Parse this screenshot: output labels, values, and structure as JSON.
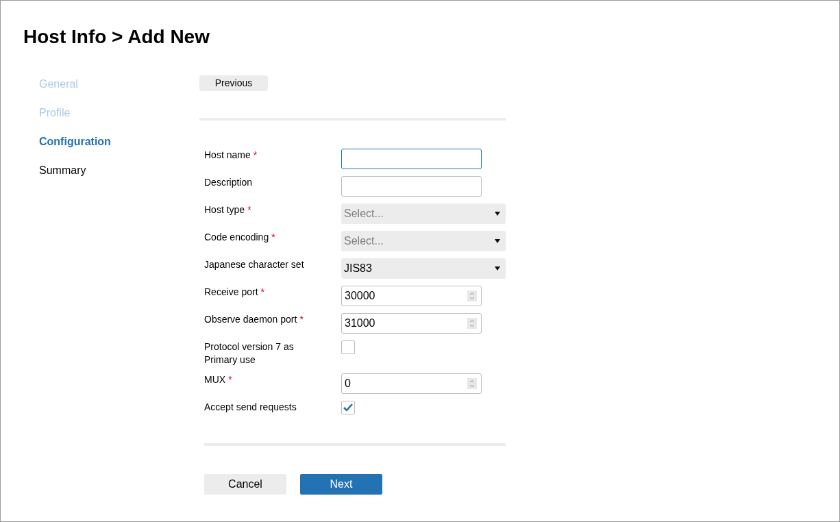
{
  "title": "Host Info > Add New",
  "steps": [
    {
      "label": "General",
      "selected": false,
      "visited": true
    },
    {
      "label": "Profile",
      "selected": false,
      "visited": true
    },
    {
      "label": "Configuration",
      "selected": true,
      "visited": true
    },
    {
      "label": "Summary",
      "selected": false,
      "visited": false
    }
  ],
  "previous_button": "Previous",
  "fields": [
    {
      "kind": "text",
      "label": "Host name",
      "required_mark": "*",
      "focused": true
    },
    {
      "kind": "text",
      "label": "Description",
      "focused": false
    },
    {
      "kind": "select",
      "label": "Host type",
      "required_mark": "*",
      "placeholder": "Select..."
    },
    {
      "kind": "select",
      "label": "Code encoding",
      "required_mark": "*",
      "placeholder": "Select..."
    },
    {
      "kind": "select",
      "label": "Japanese character set",
      "value": "JIS83"
    },
    {
      "kind": "number",
      "label": "Receive port",
      "required_mark": "*",
      "value": "30000"
    },
    {
      "kind": "number",
      "label": "Observe daemon port",
      "required_mark": "*",
      "value": "31000"
    },
    {
      "kind": "checkbox",
      "label": "Protocol version 7 as Primary use",
      "checked": false
    },
    {
      "kind": "number",
      "label": "MUX",
      "required_mark": "*",
      "value": "0"
    },
    {
      "kind": "checkbox",
      "label": "Accept send requests",
      "checked": true
    }
  ],
  "buttons": [
    {
      "label": "Cancel",
      "kind": "secondary"
    },
    {
      "label": "Next",
      "kind": "primary"
    }
  ]
}
